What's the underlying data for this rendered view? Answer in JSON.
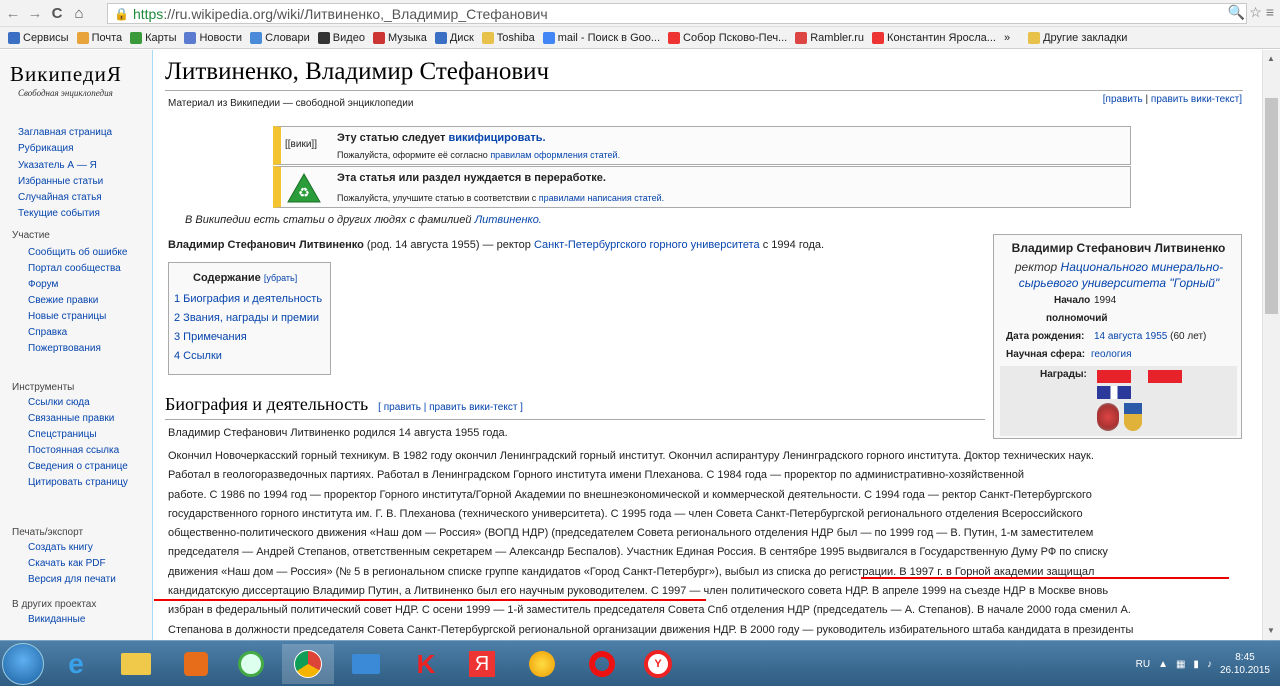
{
  "browser": {
    "url_https": "https",
    "url_rest": "://ru.wikipedia.org/wiki/Литвиненко,_Владимир_Стефанович",
    "bookmarks": [
      "Сервисы",
      "Почта",
      "Карты",
      "Новости",
      "Словари",
      "Видео",
      "Музыка",
      "Диск",
      "Toshiba",
      "mail - Поиск в Goo...",
      "Собор Псково-Печ...",
      "Rambler.ru",
      "Константин Яросла...",
      "»",
      "Другие закладки"
    ]
  },
  "sidebar": {
    "logo": "ВикипедиЯ",
    "logo_sub": "Свободная энциклопедия",
    "main": [
      "Заглавная страница",
      "Рубрикация",
      "Указатель А — Я",
      "Избранные статьи",
      "Случайная статья",
      "Текущие события"
    ],
    "participation_title": "Участие",
    "participation": [
      "Сообщить об ошибке",
      "Портал сообщества",
      "Форум",
      "Свежие правки",
      "Новые страницы",
      "Справка",
      "Пожертвования"
    ],
    "tools_title": "Инструменты",
    "tools": [
      "Ссылки сюда",
      "Связанные правки",
      "Спецстраницы",
      "Постоянная ссылка",
      "Сведения о странице",
      "Цитировать страницу"
    ],
    "print_title": "Печать/экспорт",
    "print": [
      "Создать книгу",
      "Скачать как PDF",
      "Версия для печати"
    ],
    "other_title": "В других проектах",
    "other": [
      "Викиданные"
    ]
  },
  "article": {
    "title": "Литвиненко, Владимир Стефанович",
    "subtitle": "Материал из Википедии — свободной энциклопедии",
    "edit": "[править",
    "edit_sep": " | ",
    "edit_wiki": "править вики-текст]",
    "amb1_badge": "[[вики]]",
    "amb1_title_pre": "Эту статью следует ",
    "amb1_title_link": "викифицировать.",
    "amb1_desc_pre": "Пожалуйста, оформите её согласно ",
    "amb1_desc_link": "правилам оформления статей.",
    "amb2_title": "Эта статья или раздел нуждается в переработке.",
    "amb2_desc_pre": "Пожалуйста, улучшите статью в соответствии с ",
    "amb2_desc_link": "правилами написания статей.",
    "hatnote_pre": "В Википедии есть статьи о других людях с фамилией ",
    "hatnote_link": "Литвиненко.",
    "lead_bold": "Владимир Стефанович Литвиненко",
    "lead_mid": " (род. 14 августа 1955) — ректор ",
    "lead_link": "Санкт-Петербургского горного университета",
    "lead_end": " с 1994 года.",
    "toc_title": "Содержание",
    "toc_hide": "[убрать]",
    "toc": [
      "1 Биография и деятельность",
      "2 Звания, награды и премии",
      "3 Примечания",
      "4 Ссылки"
    ],
    "section_title": "Биография и деятельность",
    "section_edit": "[ править | править вики-текст ]",
    "para1": "Владимир Стефанович Литвиненко родился 14 августа 1955 года.",
    "body_lines": [
      "Окончил Новочеркасский горный техникум. В 1982 году окончил Ленинградский горный институт. Окончил аспирантуру Ленинградского горного института. Доктор технических наук.",
      "Работал в геологоразведочных партиях. Работал в Ленинградском Горного института имени Плеханова. С 1984 года — проректор по административно-хозяйственной",
      "работе. С 1986 по 1994 год — проректор Горного института/Горной Академии по внешнеэкономической и коммерческой деятельности. С 1994 года — ректор Санкт-Петербургского",
      "государственного горного института им. Г. В. Плеханова (технического университета). С 1995 года — член Совета Санкт-Петербургской регионального отделения Всероссийского",
      "общественно-политического движения «Наш дом — Россия» (ВОПД НДР) (председателем Совета регионального отделения НДР был — по 1999 год — В. Путин, 1-м заместителем",
      "председателя — Андрей Степанов, ответственным секретарем — Александр Беспалов). Участник Единая Россия. В сентябре 1995 выдвигался в Государственную Думу РФ по списку",
      "движения «Наш дом — Россия» (№ 5 в региональном списке группе кандидатов «Город Санкт-Петербург»), выбыл из списка до регистрации. В 1997 г. в Горной академии защищал",
      "кандидатскую диссертацию Владимир Путин, а Литвиненко был его научным руководителем. С 1997 — член политического совета НДР. В апреле 1999 на съезде НДР в Москве вновь",
      "избран в федеральный политический совет НДР. С осени 1999 — 1-й заместитель председателя Совета Спб отделения НДР (председатель — А. Степанов). В начале 2000 года сменил А.",
      "Степанова в должности председателя Совета Санкт-Петербургской региональной организации движения НДР. В 2000 году — руководитель избирательного штаба кандидата в президенты"
    ]
  },
  "infobox": {
    "name": "Владимир Стефанович Литвиненко",
    "role_pre": "ректор ",
    "role_link": "Национального минерально-сырьевого университета \"Горный\"",
    "start_label": "Начало",
    "start_value": "1994",
    "start_label2": "полномочий",
    "birth_label": "Дата рождения:",
    "birth_link": "14 августа 1955",
    "birth_age": " (60 лет)",
    "science_label": "Научная сфера:",
    "science_link": "геология",
    "awards_label": "Награды:"
  },
  "taskbar": {
    "lang": "RU",
    "time": "8:45",
    "date": "26.10.2015"
  }
}
